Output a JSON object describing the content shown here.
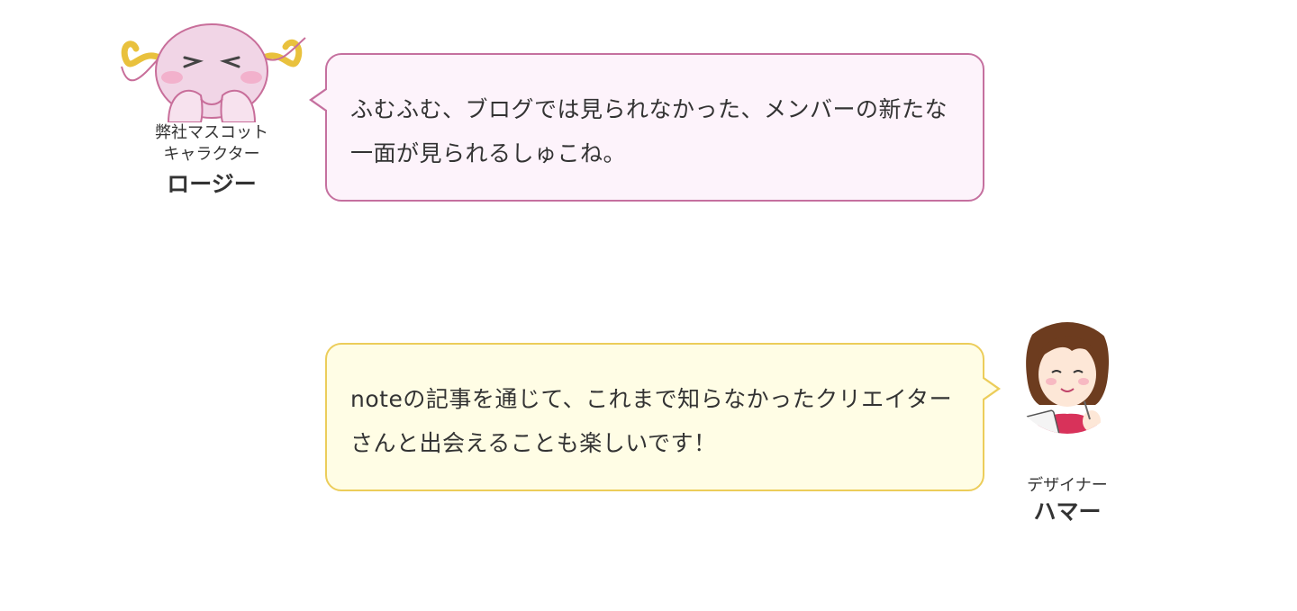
{
  "conversation": [
    {
      "speaker_role": "弊社マスコット\nキャラクター",
      "speaker_name": "ロージー",
      "avatar_icon": "pink-axolotl-mascot-icon",
      "text": "ふむふむ、ブログでは見られなかった、メンバーの新たな一面が見られるしゅこね。",
      "bubble_color": "#fdf3fb",
      "border_color": "#c5709f"
    },
    {
      "speaker_role": "デザイナー",
      "speaker_name": "ハマー",
      "avatar_icon": "woman-with-tablet-icon",
      "text": "noteの記事を通じて、これまで知らなかったクリエイターさんと出会えることも楽しいです！",
      "bubble_color": "#fffde5",
      "border_color": "#eccd5a"
    }
  ]
}
